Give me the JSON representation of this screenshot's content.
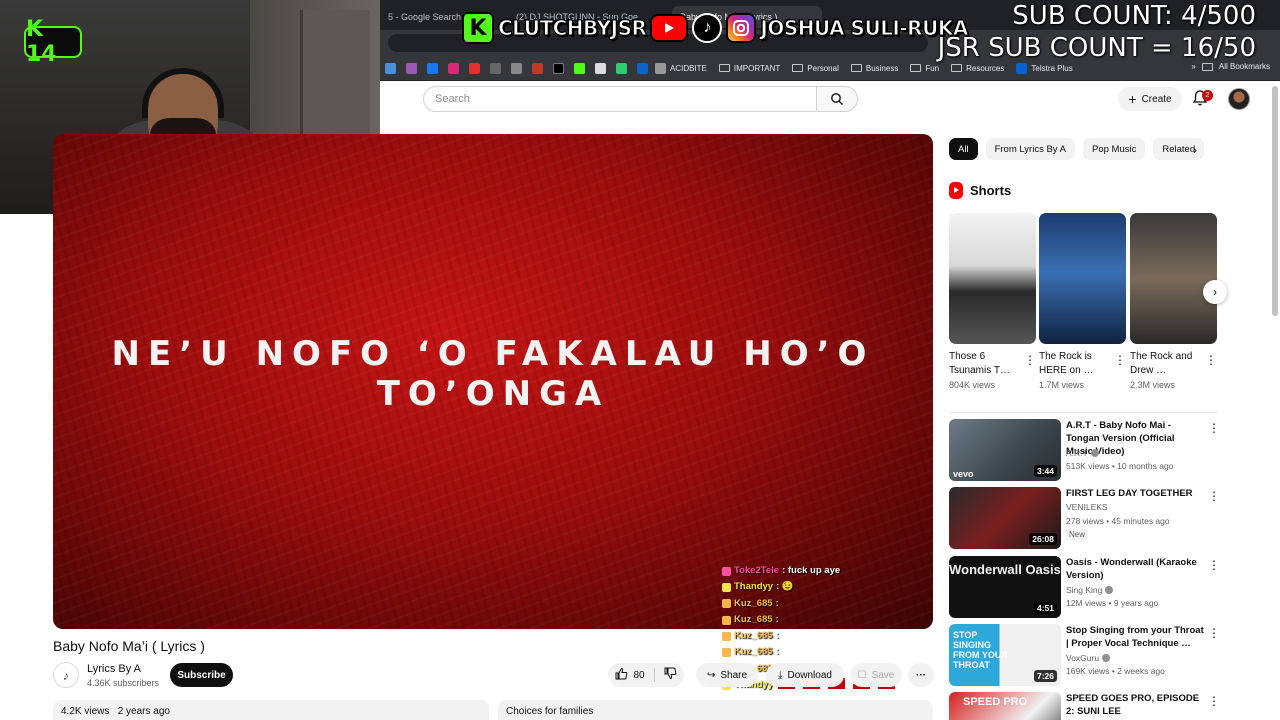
{
  "browser": {
    "tabs": [
      {
        "label": "5 - Google Search",
        "active": false
      },
      {
        "label": "(2) DJ SHOTGUNN - Sun Goez",
        "active": false
      },
      {
        "label": "Baby Nofo Ma'i ( Lyrics )",
        "active": true
      }
    ],
    "bookmarks": [
      {
        "label": "ACIDBITE",
        "type": "link"
      },
      {
        "label": "IMPORTANT",
        "type": "folder"
      },
      {
        "label": "Personal",
        "type": "folder"
      },
      {
        "label": "Business",
        "type": "folder"
      },
      {
        "label": "Fun",
        "type": "folder"
      },
      {
        "label": "Resources",
        "type": "folder"
      },
      {
        "label": "Telstra Plus",
        "type": "link"
      }
    ],
    "all_bookmarks": "All Bookmarks"
  },
  "overlay": {
    "kick_handle": "CLUTCHBYJSR",
    "social_name": "JOSHUA SULI-RUKA",
    "sub_count": "SUB COUNT: 4/500",
    "jsr_sub_count": "JSR SUB COUNT = 16/50",
    "webcam_badge": "K 14",
    "colors": {
      "kick_green": "#53fc18",
      "youtube_red": "#ff0000"
    }
  },
  "header": {
    "search_placeholder": "Search",
    "create_label": "Create",
    "notification_count": "2"
  },
  "video": {
    "lyric_text": "NE’U NOFO ‘O FAKALAU HO’O TO’ONGA",
    "title": "Baby Nofo Ma’i ( Lyrics )",
    "channel_name": "Lyrics By A",
    "channel_subs": "4.36K subscribers",
    "subscribe_label": "Subscribe",
    "likes": "80",
    "share_label": "Share",
    "download_label": "Download",
    "save_label": "Save",
    "views": "4.2K views",
    "age": "2 years ago",
    "families_label": "Choices for families"
  },
  "chat": [
    {
      "user": "Toke2Tele",
      "message": ": fuck up aye",
      "color": "#ff4fa0"
    },
    {
      "user": "Thandyy",
      "message": " : 😉",
      "color": "#f6e24a"
    },
    {
      "user": "Kuz_685",
      "message": " : ",
      "color": "#f6b84a"
    },
    {
      "user": "Kuz_685",
      "message": " : ",
      "color": "#f6b84a"
    },
    {
      "user": "Kuz_685",
      "message": " : ",
      "color": "#f6b84a"
    },
    {
      "user": "Kuz_685",
      "message": " : ",
      "color": "#f6b84a"
    },
    {
      "user": "Kuz_685",
      "message": " : ",
      "color": "#f6b84a"
    },
    {
      "user": "Thandyy",
      "message": " : ",
      "color": "#f6e24a"
    }
  ],
  "sidebar": {
    "chips": [
      {
        "label": "All",
        "active": true
      },
      {
        "label": "From Lyrics By A",
        "active": false
      },
      {
        "label": "Pop Music",
        "active": false
      },
      {
        "label": "Related",
        "active": false
      }
    ],
    "shorts_heading": "Shorts",
    "shorts": [
      {
        "title": "Those 6 Tsunamis T…",
        "views": "804K views"
      },
      {
        "title": "The Rock is HERE on …",
        "views": "1.7M views"
      },
      {
        "title": "The Rock and Drew …",
        "views": "2.3M views"
      }
    ],
    "recommendations": [
      {
        "title": "A.R.T - Baby Nofo Mai - Tongan Version (Official Music Video)",
        "channel": "A.R.T",
        "verified": true,
        "meta": "513K views • 10 months ago",
        "duration": "3:44",
        "badge": "",
        "thumb_label": "vevo"
      },
      {
        "title": "FIRST LEG DAY TOGETHER",
        "channel": "VENILEKS",
        "verified": false,
        "meta": "278 views • 45 minutes ago",
        "duration": "26:08",
        "badge": "New",
        "thumb_label": ""
      },
      {
        "title": "Oasis - Wonderwall (Karaoke Version)",
        "channel": "Sing King",
        "verified": true,
        "meta": "12M views • 9 years ago",
        "duration": "4:51",
        "badge": "",
        "thumb_label": "Wonderwall Oasis"
      },
      {
        "title": "Stop Singing from your Throat | Proper Vocal Technique …",
        "channel": "VoxGuru",
        "verified": true,
        "meta": "169K views • 2 weeks ago",
        "duration": "7:26",
        "badge": "",
        "thumb_label": "STOP SINGING FROM YOUR THROAT"
      },
      {
        "title": "SPEED GOES PRO, EPISODE 2: SUNI LEE",
        "channel": "",
        "verified": false,
        "meta": "",
        "duration": "",
        "badge": "",
        "thumb_label": "SPEED PRO"
      }
    ]
  }
}
